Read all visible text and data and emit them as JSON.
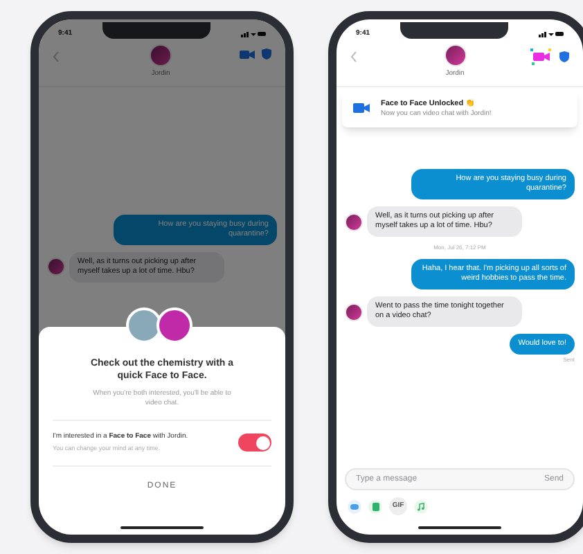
{
  "phones": [
    {
      "status_time": "9:41",
      "contact_name": "Jordin",
      "dimmed": true,
      "unlocked": false,
      "messages": [
        {
          "kind": "sent",
          "text": "How are you staying busy during quarantine?"
        },
        {
          "kind": "received",
          "text": "Well, as it turns out picking up after myself takes up a lot of time. Hbu?"
        }
      ],
      "sheet": {
        "title": "Check out the chemistry with a quick Face to Face.",
        "body": "When you're both interested, you'll be able to video chat.",
        "toggle_label": "I'm interested in a **Face to Face** with Jordin.",
        "toggle_hint": "You can change your mind at any time.",
        "toggle_on": true,
        "button": "DONE"
      }
    },
    {
      "status_time": "9:41",
      "contact_name": "Jordin",
      "dimmed": false,
      "unlocked": true,
      "notification": {
        "title": "Face to Face Unlocked 👏",
        "body": "Now you can video chat with Jordin!"
      },
      "messages": [
        {
          "kind": "sent",
          "text": "How are you staying busy during quarantine?"
        },
        {
          "kind": "received",
          "text": "Well, as it turns out picking up after myself takes up a lot of time. Hbu?"
        },
        {
          "kind": "timestamp",
          "text": "Mon, Jul 26, 7:12 PM"
        },
        {
          "kind": "sent",
          "text": "Haha, I hear that. I'm picking up all sorts of weird hobbies to pass the time."
        },
        {
          "kind": "received",
          "text": "Went to pass the time tonight together on a video chat?"
        },
        {
          "kind": "sent",
          "text": "Would love to!"
        },
        {
          "kind": "status",
          "text": "Sent"
        }
      ],
      "composer": {
        "placeholder": "Type a message",
        "send": "Send",
        "gif": "GIF"
      }
    }
  ]
}
